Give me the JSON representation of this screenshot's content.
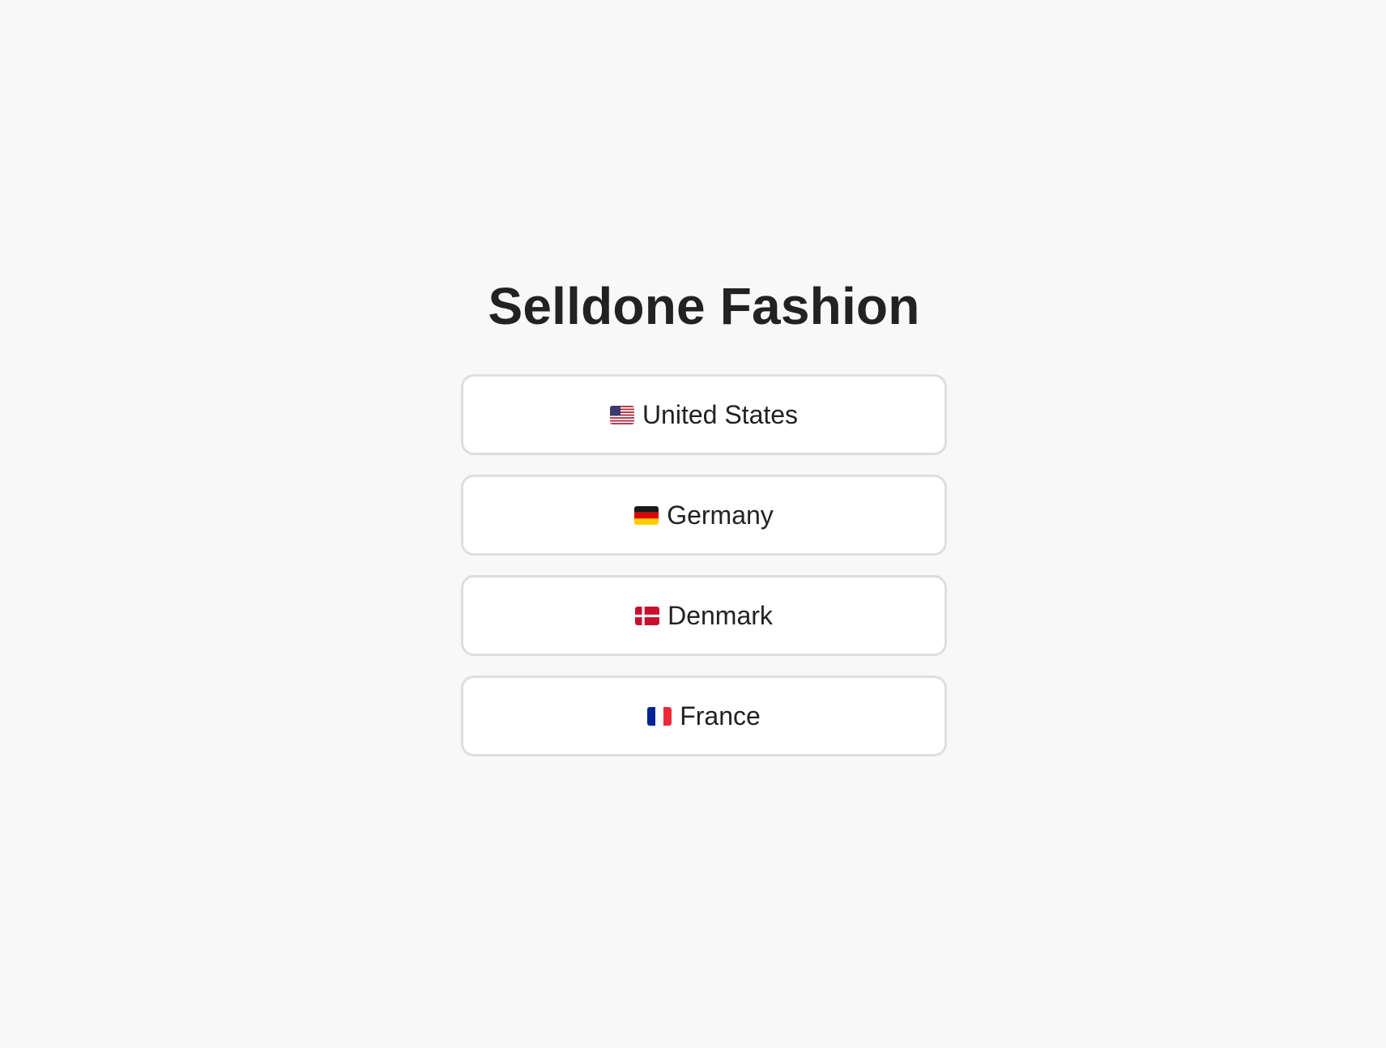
{
  "title": "Selldone Fashion",
  "countries": [
    {
      "label": "United States",
      "flag_icon": "us-flag-icon"
    },
    {
      "label": "Germany",
      "flag_icon": "germany-flag-icon"
    },
    {
      "label": "Denmark",
      "flag_icon": "denmark-flag-icon"
    },
    {
      "label": "France",
      "flag_icon": "france-flag-icon"
    }
  ],
  "colors": {
    "background": "#f8f8f8",
    "text": "#222222",
    "button_border": "#dedede",
    "button_bg": "#ffffff"
  }
}
